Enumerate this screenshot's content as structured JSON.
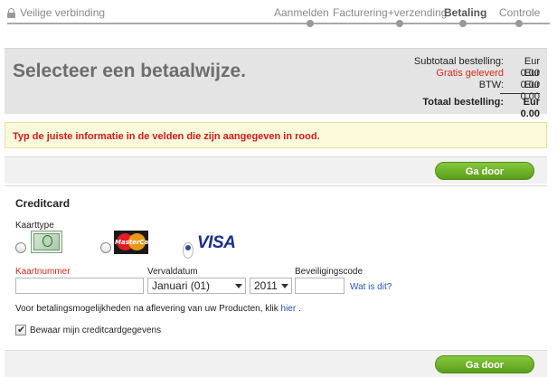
{
  "header": {
    "secure_label": "Veilige verbinding",
    "steps": [
      {
        "label": "Aanmelden",
        "active": false
      },
      {
        "label": "Facturering+verzending",
        "active": false
      },
      {
        "label": "Betaling",
        "active": true
      },
      {
        "label": "Controle",
        "active": false
      }
    ]
  },
  "summary": {
    "title": "Selecteer een betaalwijze.",
    "subtotal_label": "Subtotaal bestelling:",
    "subtotal_value": "Eur 0.00",
    "shipping_label": "Gratis geleverd",
    "shipping_value": "Eur 0.00",
    "vat_label": "BTW:",
    "vat_value": "Eur 0.00",
    "total_label": "Totaal bestelling:",
    "total_value": "Eur 0.00"
  },
  "error_message": "Typ de juiste informatie in de velden die zijn aangegeven in rood.",
  "buttons": {
    "continue_top": "Ga door",
    "continue_bottom": "Ga door"
  },
  "creditcard": {
    "title": "Creditcard",
    "card_type_label": "Kaarttype",
    "cards": [
      {
        "name": "American Express",
        "selected": false,
        "icon": "amex-card-icon"
      },
      {
        "name": "MasterCard",
        "selected": false,
        "icon": "mastercard-icon",
        "logo_text": "MasterCard"
      },
      {
        "name": "VISA",
        "selected": true,
        "icon": "visa-icon",
        "logo_text": "VISA"
      }
    ],
    "card_number_label": "Kaartnummer",
    "card_number_value": "",
    "expiry_label": "Vervaldatum",
    "expiry_month": "Januari (01)",
    "expiry_year": "2011",
    "security_code_label": "Beveiligingscode",
    "security_code_value": "",
    "what_is_this": "Wat is dit?",
    "info_text": "Voor betalingsmogelijkheden na aflevering van uw Producten, klik",
    "info_link": "hier",
    "info_end": ".",
    "save_label": "Bewaar mijn creditcardgegevens",
    "save_checked": true
  },
  "colors": {
    "accent_green": "#6fb22a",
    "error_red": "#d01818",
    "link_blue": "#2457b5"
  }
}
